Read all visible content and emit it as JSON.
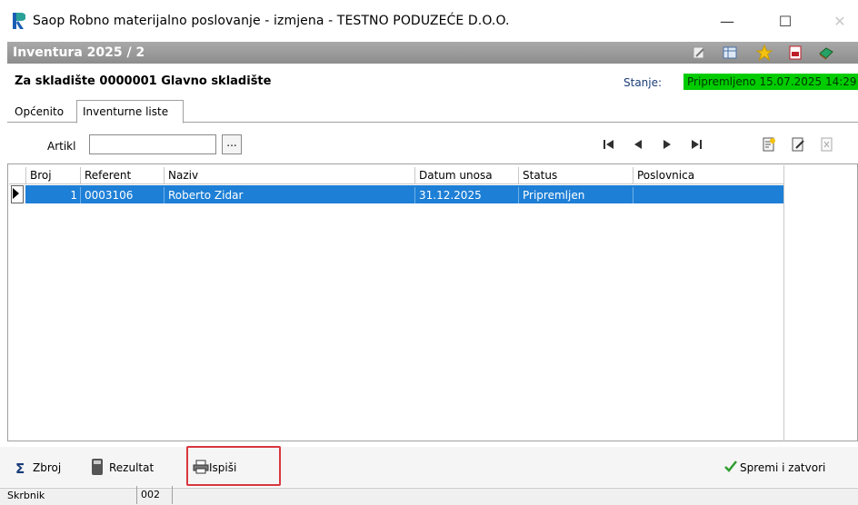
{
  "window": {
    "title": "Saop Robno materijalno poslovanje - izmjena  - TESTNO PODUZEĆE D.O.O.",
    "minimize": "—",
    "maximize": "☐",
    "close": "✕"
  },
  "header": {
    "doc_title": "Inventura 2025 / 2",
    "icons": [
      "edit-icon",
      "table-icon",
      "star-icon",
      "document-red-icon",
      "book-green-icon"
    ]
  },
  "warehouse": {
    "text": "Za skladište  0000001 Glavno skladište",
    "state_label": "Stanje:",
    "state_value": "Pripremljeno 15.07.2025 14:29",
    "state_color": "#00cc00"
  },
  "tabs": [
    {
      "label": "Općenito"
    },
    {
      "label": "Inventurne liste"
    }
  ],
  "filter": {
    "label": "Artikl",
    "value": "",
    "lookup": "..."
  },
  "grid": {
    "columns": [
      "Broj",
      "Referent",
      "Naziv",
      "Datum unosa",
      "Status",
      "Poslovnica"
    ],
    "rows": [
      {
        "broj": "1",
        "referent": "0003106",
        "naziv": "Roberto Zidar",
        "datum": "31.12.2025",
        "status": "Pripremljen",
        "poslovnica": ""
      }
    ],
    "selected_color": "#1e7fd6"
  },
  "buttons": {
    "zbroj": "Zbroj",
    "rezultat": "Rezultat",
    "ispisi": "Ispiši",
    "save": "Spremi i zatvori"
  },
  "status": {
    "left": "Skrbnik",
    "mid": "002"
  }
}
